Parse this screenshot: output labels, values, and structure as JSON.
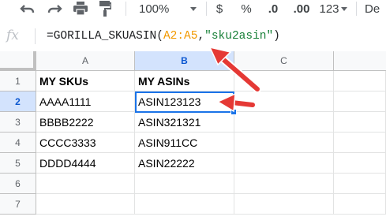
{
  "toolbar": {
    "zoom": "100%",
    "currency": "$",
    "percent": "%",
    "decrease_decimal": ".0",
    "increase_decimal": ".00",
    "more_formats": "123",
    "font_partial": "De"
  },
  "formula_bar": {
    "fx_label": "fx",
    "fn_part": "=GORILLA_SKUASIN(",
    "range_part": "A2:A5",
    "comma_part": ",",
    "string_part": "\"sku2asin\"",
    "close_part": ")"
  },
  "columns": [
    "A",
    "B",
    "C"
  ],
  "rows": [
    "1",
    "2",
    "3",
    "4",
    "5",
    "6",
    "7"
  ],
  "cells": [
    [
      "MY SKUs",
      "MY ASINs",
      ""
    ],
    [
      "AAAA1111",
      "ASIN123123",
      ""
    ],
    [
      "BBBB2222",
      "ASIN321321",
      ""
    ],
    [
      "CCCC3333",
      "ASIN911CC",
      ""
    ],
    [
      "DDDD4444",
      "ASIN22222",
      ""
    ],
    [
      "",
      "",
      ""
    ],
    [
      "",
      "",
      ""
    ]
  ],
  "selected_cell": "B2",
  "colors": {
    "selection": "#1a73e8",
    "arrow": "#e53935",
    "range_ref": "#f29900",
    "string_lit": "#188038"
  },
  "icons": [
    "undo-icon",
    "redo-icon",
    "print-icon",
    "paint-format-icon"
  ]
}
